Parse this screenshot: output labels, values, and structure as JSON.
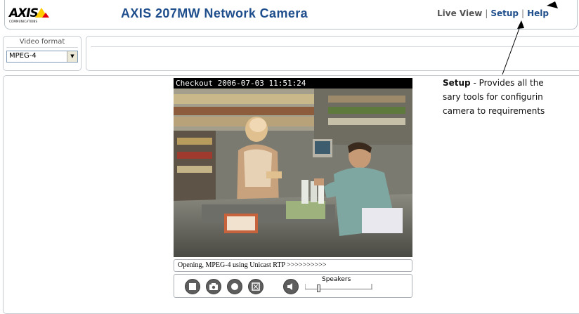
{
  "header": {
    "logo_text": "AXIS",
    "logo_subtext": "COMMUNICATIONS",
    "title": "AXIS 207MW Network Camera",
    "nav": {
      "live_view": "Live View",
      "separator": "|",
      "setup": "Setup",
      "help": "Help"
    }
  },
  "video_format": {
    "label": "Video format",
    "selected": "MPEG-4"
  },
  "video": {
    "overlay_text": "Checkout 2006-07-03 11:51:24",
    "status_text": "Opening, MPEG-4 using Unicast RTP >>>>>>>>>>",
    "controls": {
      "stop_icon": "stop-icon",
      "snapshot_icon": "camera-icon",
      "record_icon": "record-icon",
      "fullscreen_icon": "fullscreen-icon",
      "speaker_icon": "speaker-icon",
      "speakers_label": "Speakers"
    },
    "volume_level": 0.2
  },
  "annotation": {
    "term": "Setup",
    "line1_rest": " - Provides all the",
    "line2": "sary tools for configurin",
    "line3": "camera to requirements"
  },
  "colors": {
    "title_blue": "#1f4e8c",
    "link_blue": "#1f4e8c",
    "logo_yellow": "#ffcc00",
    "logo_red": "#e2000f",
    "panel_border": "#c6ccd2"
  }
}
